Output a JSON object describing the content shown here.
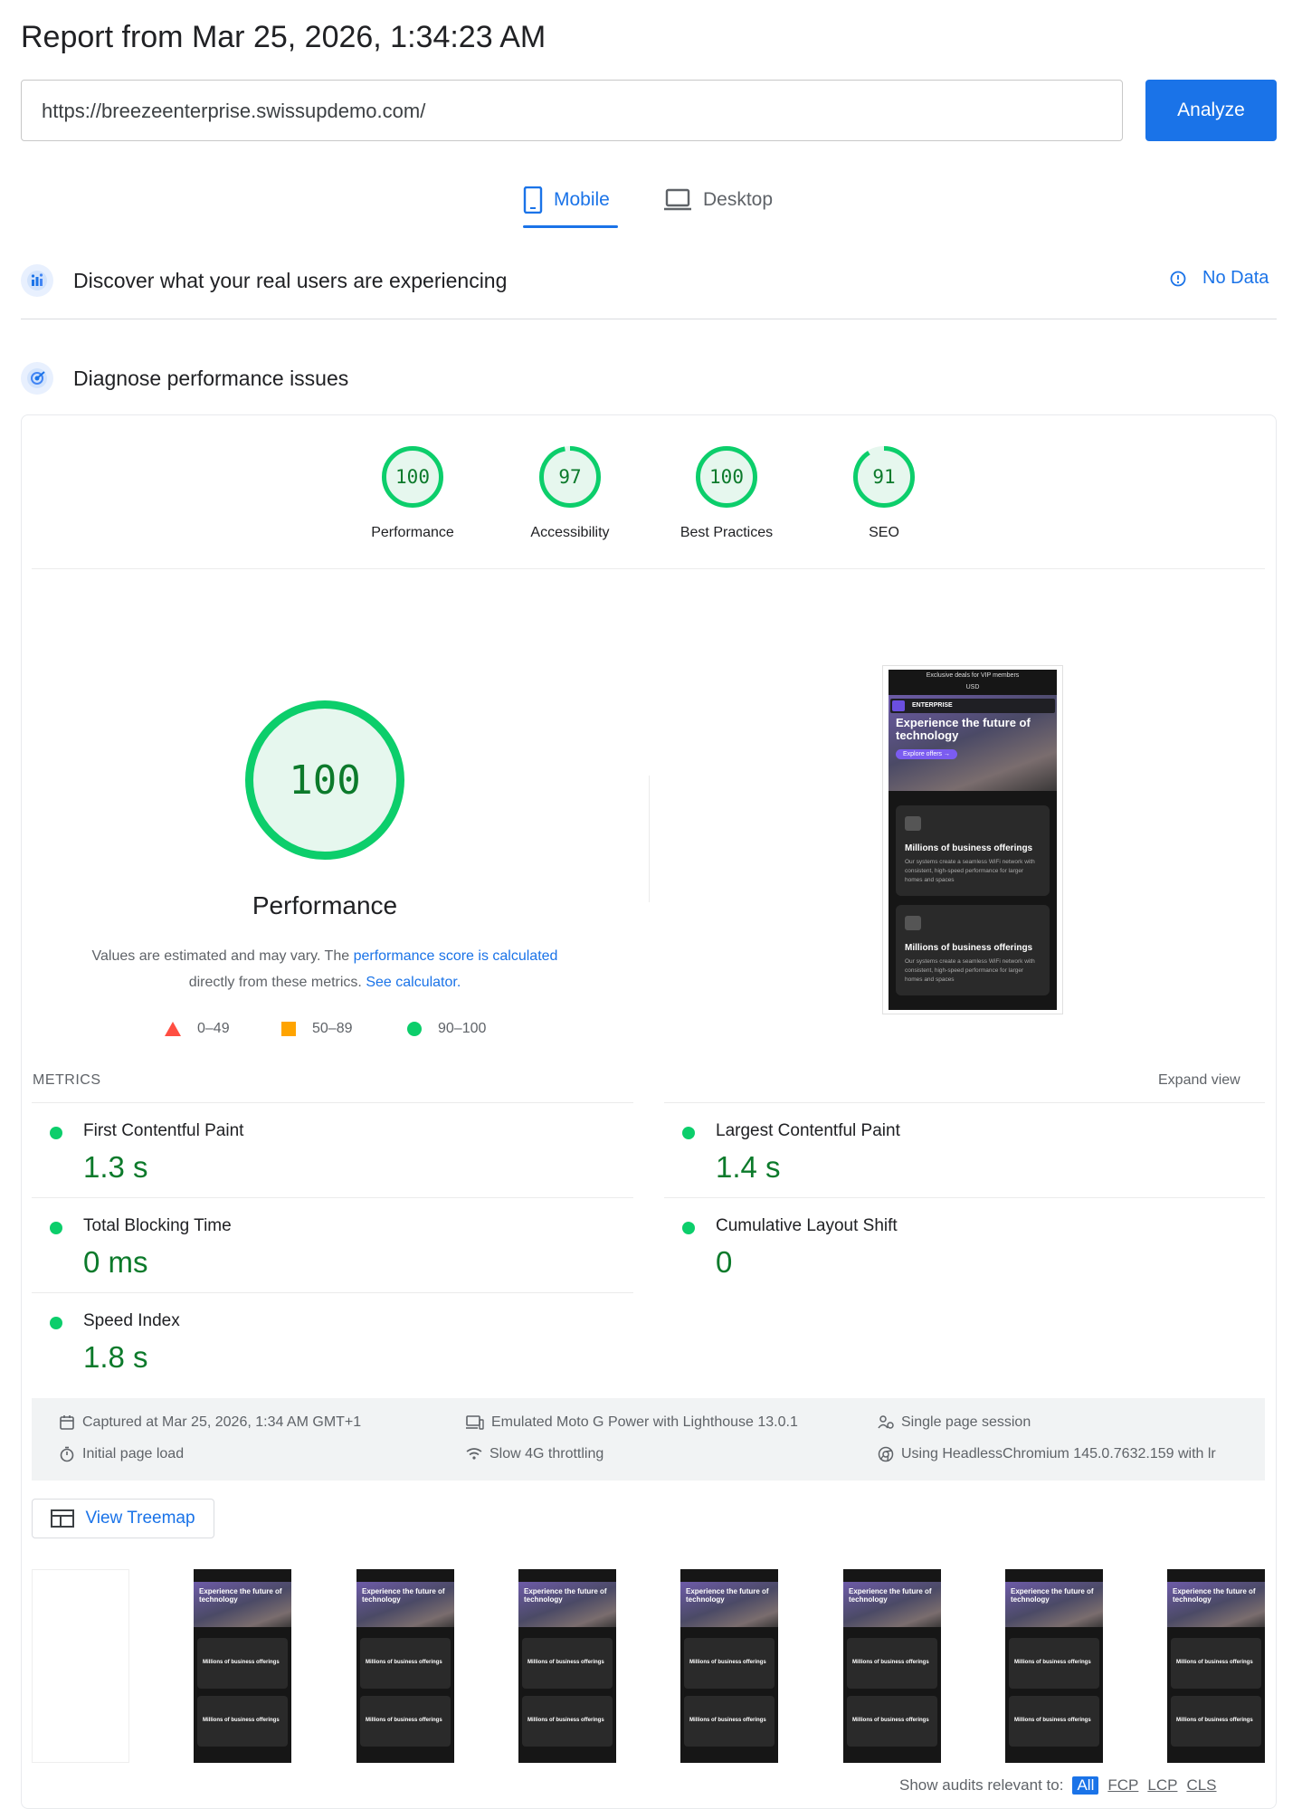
{
  "header": {
    "title": "Report from Mar 25, 2026, 1:34:23 AM"
  },
  "url_bar": {
    "value": "https://breezeenterprise.swissupdemo.com/",
    "analyze_label": "Analyze"
  },
  "tabs": [
    {
      "label": "Mobile",
      "active": true
    },
    {
      "label": "Desktop",
      "active": false
    }
  ],
  "field_data": {
    "heading": "Discover what your real users are experiencing",
    "status": "No Data"
  },
  "lab": {
    "heading": "Diagnose performance issues",
    "categories": [
      {
        "label": "Performance",
        "score": "100",
        "fraction": 1.0
      },
      {
        "label": "Accessibility",
        "score": "97",
        "fraction": 0.97
      },
      {
        "label": "Best Practices",
        "score": "100",
        "fraction": 1.0
      },
      {
        "label": "SEO",
        "score": "91",
        "fraction": 0.91
      }
    ],
    "main_gauge": {
      "score": "100",
      "title": "Performance",
      "fraction": 1.0
    },
    "desc": {
      "part1": "Values are estimated and may vary. The ",
      "link1": "performance score is calculated",
      "part2": " directly from these metrics. ",
      "link2": "See calculator."
    },
    "legend": [
      "0–49",
      "50–89",
      "90–100"
    ]
  },
  "screenshot": {
    "banner": "Exclusive deals for VIP members",
    "currency": "USD",
    "brand": "ENTERPRISE",
    "hero_title": "Experience the future of technology",
    "hero_button": "Explore offers →",
    "card_title": "Millions of business offerings",
    "card_text": "Our systems create a seamless WiFi network with consistent, high-speed performance for larger homes and spaces"
  },
  "metrics": {
    "label": "METRICS",
    "expand": "Expand view",
    "items": [
      {
        "name": "First Contentful Paint",
        "value": "1.3 s"
      },
      {
        "name": "Largest Contentful Paint",
        "value": "1.4 s"
      },
      {
        "name": "Total Blocking Time",
        "value": "0 ms"
      },
      {
        "name": "Cumulative Layout Shift",
        "value": "0"
      },
      {
        "name": "Speed Index",
        "value": "1.8 s"
      }
    ]
  },
  "env": {
    "captured": "Captured at Mar 25, 2026, 1:34 AM GMT+1",
    "load": "Initial page load",
    "device": "Emulated Moto G Power with Lighthouse 13.0.1",
    "throttling": "Slow 4G throttling",
    "session": "Single page session",
    "browser": "Using HeadlessChromium 145.0.7632.159 with lr"
  },
  "treemap": {
    "label": "View Treemap"
  },
  "footer": {
    "label": "Show audits relevant to:",
    "filters": [
      "All",
      "FCP",
      "LCP",
      "CLS"
    ]
  },
  "colors": {
    "pass": "#0cce6b",
    "pass_text": "#0c7a2b",
    "average": "#ffa400",
    "fail": "#ff4e42",
    "accent": "#1a73e8"
  }
}
